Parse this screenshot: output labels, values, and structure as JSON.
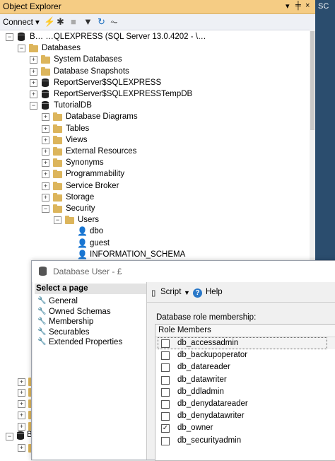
{
  "object_explorer": {
    "title": "Object Explorer",
    "pin_icons": "▾ ╪ ×",
    "side_tab": "SC",
    "toolbar": {
      "connect": "Connect ▾",
      "icons": [
        "connect-icon",
        "disconnect-icon",
        "stop-icon",
        "filter-icon",
        "refresh-icon",
        "activity-icon"
      ]
    },
    "tree": [
      {
        "label": "B…          …QLEXPRESS (SQL Server 13.0.4202 - \\…",
        "icon": "server",
        "expand": "-"
      },
      {
        "label": "Databases",
        "icon": "folder",
        "expand": "-"
      },
      {
        "label": "System Databases",
        "icon": "folder",
        "expand": "+"
      },
      {
        "label": "Database Snapshots",
        "icon": "folder",
        "expand": "+"
      },
      {
        "label": "ReportServer$SQLEXPRESS",
        "icon": "db",
        "expand": "+"
      },
      {
        "label": "ReportServer$SQLEXPRESSTempDB",
        "icon": "db",
        "expand": "+"
      },
      {
        "label": "TutorialDB",
        "icon": "db",
        "expand": "-"
      },
      {
        "label": "Database Diagrams",
        "icon": "folder",
        "expand": "+"
      },
      {
        "label": "Tables",
        "icon": "folder",
        "expand": "+"
      },
      {
        "label": "Views",
        "icon": "folder",
        "expand": "+"
      },
      {
        "label": "External Resources",
        "icon": "folder",
        "expand": "+"
      },
      {
        "label": "Synonyms",
        "icon": "folder",
        "expand": "+"
      },
      {
        "label": "Programmability",
        "icon": "folder",
        "expand": "+"
      },
      {
        "label": "Service Broker",
        "icon": "folder",
        "expand": "+"
      },
      {
        "label": "Storage",
        "icon": "folder",
        "expand": "+"
      },
      {
        "label": "Security",
        "icon": "folder",
        "expand": "-"
      },
      {
        "label": "Users",
        "icon": "folder",
        "expand": "-"
      },
      {
        "label": "dbo",
        "icon": "user",
        "expand": ""
      },
      {
        "label": "guest",
        "icon": "user-x",
        "expand": ""
      },
      {
        "label": "INFORMATION_SCHEMA",
        "icon": "user-x",
        "expand": ""
      }
    ],
    "bottom_server_label": "B"
  },
  "dialog": {
    "title": "Database User - £",
    "select_page": "Select a page",
    "pages": [
      "General",
      "Owned Schemas",
      "Membership",
      "Securables",
      "Extended Properties"
    ],
    "toolbar": {
      "script": "Script",
      "help": "Help"
    },
    "section_label": "Database role membership:",
    "grid_header": "Role Members",
    "roles": [
      {
        "name": "db_accessadmin",
        "checked": false,
        "selected": true
      },
      {
        "name": "db_backupoperator",
        "checked": false,
        "selected": false
      },
      {
        "name": "db_datareader",
        "checked": false,
        "selected": false
      },
      {
        "name": "db_datawriter",
        "checked": false,
        "selected": false
      },
      {
        "name": "db_ddladmin",
        "checked": false,
        "selected": false
      },
      {
        "name": "db_denydatareader",
        "checked": false,
        "selected": false
      },
      {
        "name": "db_denydatawriter",
        "checked": false,
        "selected": false
      },
      {
        "name": "db_owner",
        "checked": true,
        "selected": false
      },
      {
        "name": "db_securityadmin",
        "checked": false,
        "selected": false
      }
    ]
  },
  "colors": {
    "title_bar": "#f5cc84",
    "folder": "#dcb55c",
    "side_strip": "#2b4d6e"
  }
}
